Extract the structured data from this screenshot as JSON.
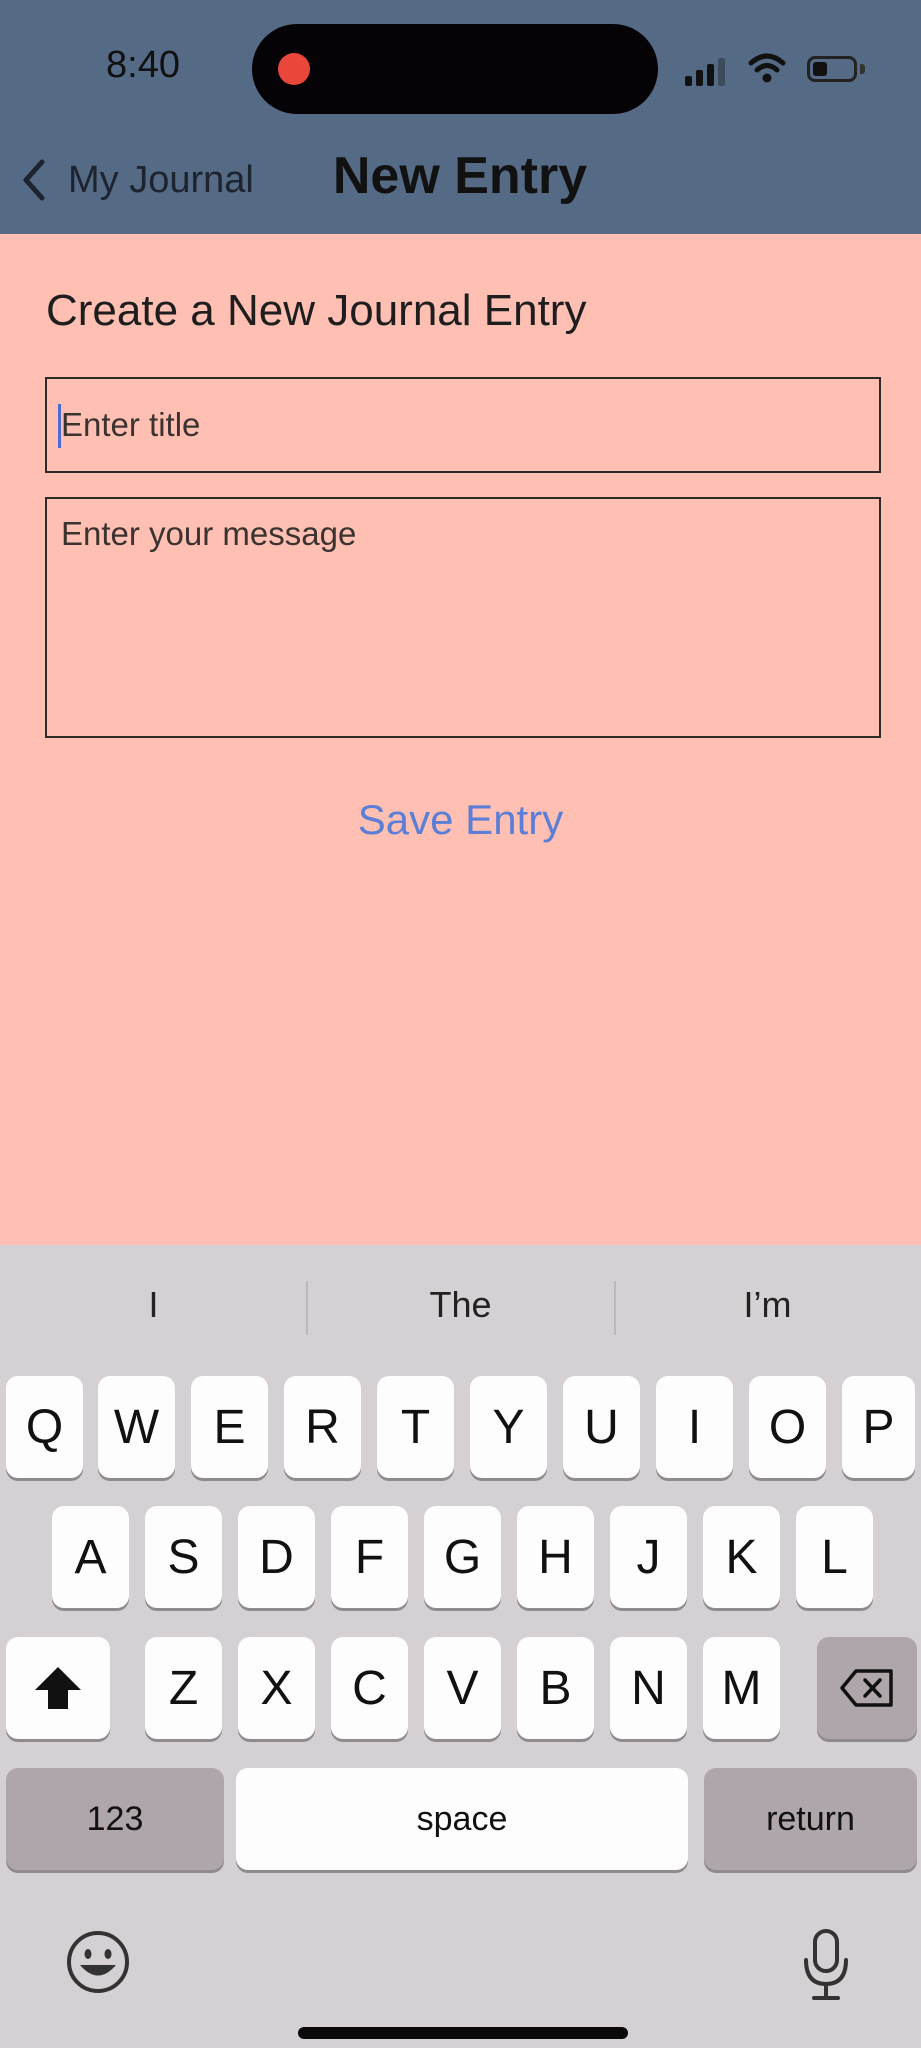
{
  "status_bar": {
    "time": "8:40",
    "icons": [
      "signal-icon",
      "wifi-icon",
      "battery-icon"
    ],
    "recording_dot_color": "#e9473a"
  },
  "nav": {
    "back_label": "My Journal",
    "title": "New Entry",
    "background_color": "#546a85"
  },
  "form": {
    "heading": "Create a New Journal Entry",
    "title_placeholder": "Enter title",
    "message_placeholder": "Enter your message",
    "save_label": "Save Entry",
    "background_color": "#ffbfb3",
    "accent_color": "#5b7fd6"
  },
  "keyboard": {
    "suggestions": [
      "I",
      "The",
      "I’m"
    ],
    "row1": [
      "Q",
      "W",
      "E",
      "R",
      "T",
      "Y",
      "U",
      "I",
      "O",
      "P"
    ],
    "row2": [
      "A",
      "S",
      "D",
      "F",
      "G",
      "H",
      "J",
      "K",
      "L"
    ],
    "row3": [
      "Z",
      "X",
      "C",
      "V",
      "B",
      "N",
      "M"
    ],
    "numbers_label": "123",
    "space_label": "space",
    "return_label": "return"
  }
}
